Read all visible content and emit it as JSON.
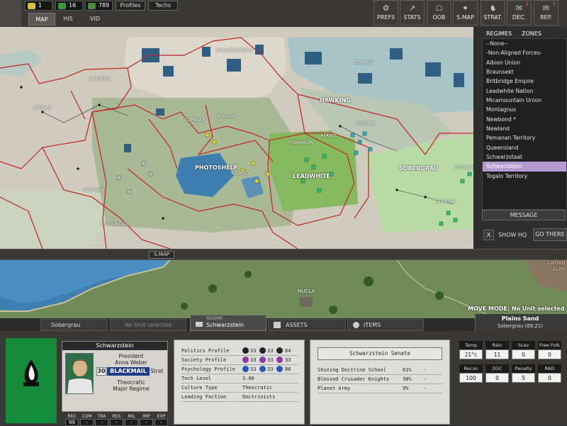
{
  "resources": [
    {
      "value": "1",
      "color": "#d8c23a"
    },
    {
      "value": "16",
      "color": "#3e9a3e"
    },
    {
      "value": "789",
      "color": "#4c8c3c"
    }
  ],
  "top_buttons": {
    "profiles": "Profiles",
    "techs": "Techs"
  },
  "view_tabs": {
    "map": "MAP",
    "his": "HIS",
    "vid": "VID"
  },
  "nav": [
    {
      "label": "PREFS",
      "icon": "⚙"
    },
    {
      "label": "STATS",
      "icon": "↗"
    },
    {
      "label": "OOB",
      "icon": "☖"
    },
    {
      "label": "S.MAP",
      "icon": "✦"
    },
    {
      "label": "STRAT.",
      "icon": "♞"
    },
    {
      "label": "DEC.",
      "icon": "✉",
      "badge": "2"
    },
    {
      "label": "REP.",
      "icon": "✉",
      "badge": "1"
    }
  ],
  "right_panel": {
    "tab_regimes": "REGIMES",
    "tab_zones": "ZONES",
    "regimes": [
      "--None--",
      "-Non-Aligned Forces-",
      "Albion Union",
      "Braunsekt",
      "Britbridge Empire",
      "Leadwhite Nation",
      "Micamountain Union",
      "Montagnus",
      "Newbond *",
      "Newland",
      "Pemanan Territory",
      "Queensland",
      "Schwarzstaat",
      "Schwarzstein",
      "Togalo Territory"
    ],
    "selected_index": 13,
    "message": "MESSAGE",
    "show_hq": "SHOW HQ",
    "show_hq_mark": "X",
    "go_there": "GO THERE"
  },
  "map_labels": [
    "MICAMOUNTAIN",
    "ZEMIRO",
    "NAXXOPE",
    "ALTKAU",
    "HAWKING",
    "TOPELAR",
    "AVALON",
    "TOFARIO",
    "AFARO",
    "PEMANION",
    "PHOTOSHELF",
    "EZONIO",
    "LEADWHITE",
    "SOBERGRAU",
    "ECONUM",
    "POITNON",
    "BRITBRIDGE",
    "ZEPOTIO"
  ],
  "mid_bar": {
    "smap_label": "S.MAP"
  },
  "strategic_labels": {
    "nucla": "NUCLA",
    "catian": "CATIAN",
    "alps": "ALPS"
  },
  "move_mode": "MOVE MODE: No Unit selected",
  "hex_info": {
    "terrain": "Plains Sand",
    "coords": "Sobergrau (69,21)"
  },
  "bottom_tabs": {
    "hex": "Sobergrau",
    "unit": "No Unit selected",
    "regime_small": "REGIME",
    "regime": "Schwarzstein",
    "assets": "ASSETS",
    "items": "ITEMS"
  },
  "leader": {
    "name": "Schwarzstein",
    "title": "President",
    "person": "Anna Weber",
    "level": "30",
    "trait": "BLACKMAIL",
    "trait_type": "Strat",
    "regime_type": "Theocratic",
    "regime_size": "Major Regime"
  },
  "leader_stats": [
    {
      "label": "REC",
      "value": "99"
    },
    {
      "label": "COM",
      "value": "-"
    },
    {
      "label": "TRA",
      "value": "-"
    },
    {
      "label": "RES",
      "value": "-"
    },
    {
      "label": "MIL",
      "value": "-"
    },
    {
      "label": "IMP",
      "value": "-"
    },
    {
      "label": "EXP",
      "value": "-"
    }
  ],
  "profiles": [
    {
      "label": "Politics Profile",
      "values": [
        "33",
        "33",
        "64"
      ]
    },
    {
      "label": "Society Profile",
      "values": [
        "33",
        "33",
        "33"
      ]
    },
    {
      "label": "Psychology Profile",
      "values": [
        "33",
        "33",
        "88"
      ]
    },
    {
      "label": "Tech Level",
      "values": [
        "3.00"
      ]
    },
    {
      "label": "Culture Type",
      "values": [
        "Theocratic"
      ]
    },
    {
      "label": "Leading Faction",
      "values": [
        "Doctrinists"
      ]
    }
  ],
  "senate": {
    "title": "Schwarzstein Senate",
    "rows": [
      {
        "name": "Shining Doctrine School",
        "pct": "61%",
        "extra": "-"
      },
      {
        "name": "Blessed Crusader Knights",
        "pct": "30%",
        "extra": "-"
      },
      {
        "name": "Planet Army",
        "pct": "9%",
        "extra": "-"
      }
    ]
  },
  "hex_stats": [
    {
      "label": "Temp",
      "value": "21°c"
    },
    {
      "label": "Rain",
      "value": "11"
    },
    {
      "label": "Scav",
      "value": "0"
    },
    {
      "label": "Free Folk",
      "value": "0"
    },
    {
      "label": "Recon",
      "value": "100"
    },
    {
      "label": "ZOC",
      "value": "0"
    },
    {
      "label": "Penalty",
      "value": "5"
    },
    {
      "label": "RAD",
      "value": "0"
    }
  ]
}
